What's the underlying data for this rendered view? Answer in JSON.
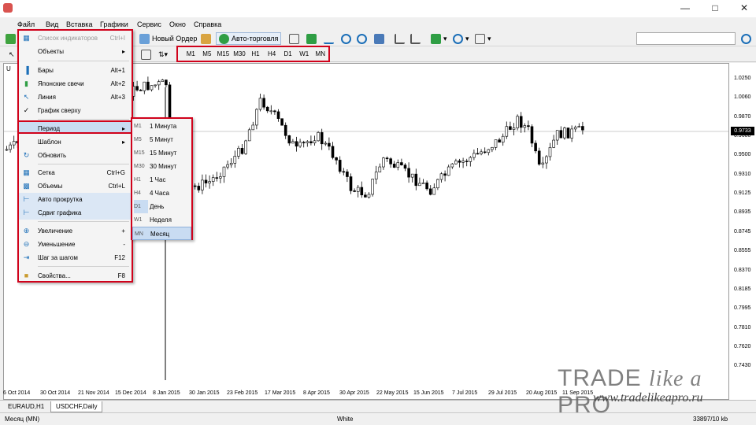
{
  "menubar": {
    "items": [
      "Файл",
      "Вид",
      "Вставка",
      "Графики",
      "Сервис",
      "Окно",
      "Справка"
    ]
  },
  "toolbar": {
    "new_order": "Новый Ордер",
    "auto_trading": "Авто-торговля"
  },
  "periods": [
    "M1",
    "M5",
    "M15",
    "M30",
    "H1",
    "H4",
    "D1",
    "W1",
    "MN"
  ],
  "dropdown": {
    "items": [
      {
        "label": "Список индикаторов",
        "shortcut": "Ctrl+I",
        "icon": "indicator-list-icon",
        "disabled": true
      },
      {
        "label": "Объекты",
        "shortcut": "",
        "icon": "",
        "arrow": true
      },
      {
        "label": "Бары",
        "shortcut": "Alt+1",
        "icon": "bars-icon"
      },
      {
        "label": "Японские свечи",
        "shortcut": "Alt+2",
        "icon": "candles-icon"
      },
      {
        "label": "Линия",
        "shortcut": "Alt+3",
        "icon": "line-icon"
      },
      {
        "label": "График сверху",
        "shortcut": "",
        "icon": "checkmark-icon"
      },
      {
        "label": "Период",
        "shortcut": "",
        "icon": "",
        "arrow": true,
        "highlight": true
      },
      {
        "label": "Шаблон",
        "shortcut": "",
        "icon": "",
        "arrow": true
      },
      {
        "label": "Обновить",
        "shortcut": "",
        "icon": "refresh-icon"
      },
      {
        "label": "Сетка",
        "shortcut": "Ctrl+G",
        "icon": "grid-icon"
      },
      {
        "label": "Объемы",
        "shortcut": "Ctrl+L",
        "icon": "volumes-icon"
      },
      {
        "label": "Авто прокрутка",
        "shortcut": "",
        "icon": "autoscroll-icon"
      },
      {
        "label": "Сдвиг графика",
        "shortcut": "",
        "icon": "chart-shift-icon"
      },
      {
        "label": "Увеличение",
        "shortcut": "+",
        "icon": "zoom-in-icon"
      },
      {
        "label": "Уменьшение",
        "shortcut": "-",
        "icon": "zoom-out-icon"
      },
      {
        "label": "Шаг за шагом",
        "shortcut": "F12",
        "icon": "step-icon"
      },
      {
        "label": "Свойства...",
        "shortcut": "F8",
        "icon": "properties-icon"
      }
    ]
  },
  "submenu": {
    "items": [
      {
        "code": "M1",
        "label": "1 Минута"
      },
      {
        "code": "M5",
        "label": "5 Минут"
      },
      {
        "code": "M15",
        "label": "15 Минут"
      },
      {
        "code": "M30",
        "label": "30 Минут"
      },
      {
        "code": "H1",
        "label": "1 Час"
      },
      {
        "code": "H4",
        "label": "4 Часа"
      },
      {
        "code": "D1",
        "label": "День"
      },
      {
        "code": "W1",
        "label": "Неделя"
      },
      {
        "code": "MN",
        "label": "Месяц"
      }
    ],
    "selected": "MN"
  },
  "chart": {
    "symbol_label": "U",
    "current_price": "0.9733",
    "price_labels": [
      "1.0250",
      "1.0060",
      "0.9870",
      "0.9680",
      "0.9500",
      "0.9310",
      "0.9125",
      "0.8935",
      "0.8745",
      "0.8555",
      "0.8370",
      "0.8185",
      "0.7995",
      "0.7810",
      "0.7620",
      "0.7430"
    ],
    "date_labels": [
      "6 Oct 2014",
      "30 Oct 2014",
      "21 Nov 2014",
      "15 Dec 2014",
      "8 Jan 2015",
      "30 Jan 2015",
      "23 Feb 2015",
      "17 Mar 2015",
      "8 Apr 2015",
      "30 Apr 2015",
      "22 May 2015",
      "15 Jun 2015",
      "7 Jul 2015",
      "29 Jul 2015",
      "20 Aug 2015",
      "11 Sep 2015"
    ]
  },
  "tabs": [
    "EURAUD,H1",
    "USDCHF,Daily"
  ],
  "status": {
    "left": "Месяц (MN)",
    "middle": "White",
    "right": "33897/10 kb"
  },
  "watermark": {
    "brand_plain": "TRADE",
    "brand_italic": "like a",
    "brand_end": "PRO",
    "url": "www.tradelikeapro.ru"
  }
}
